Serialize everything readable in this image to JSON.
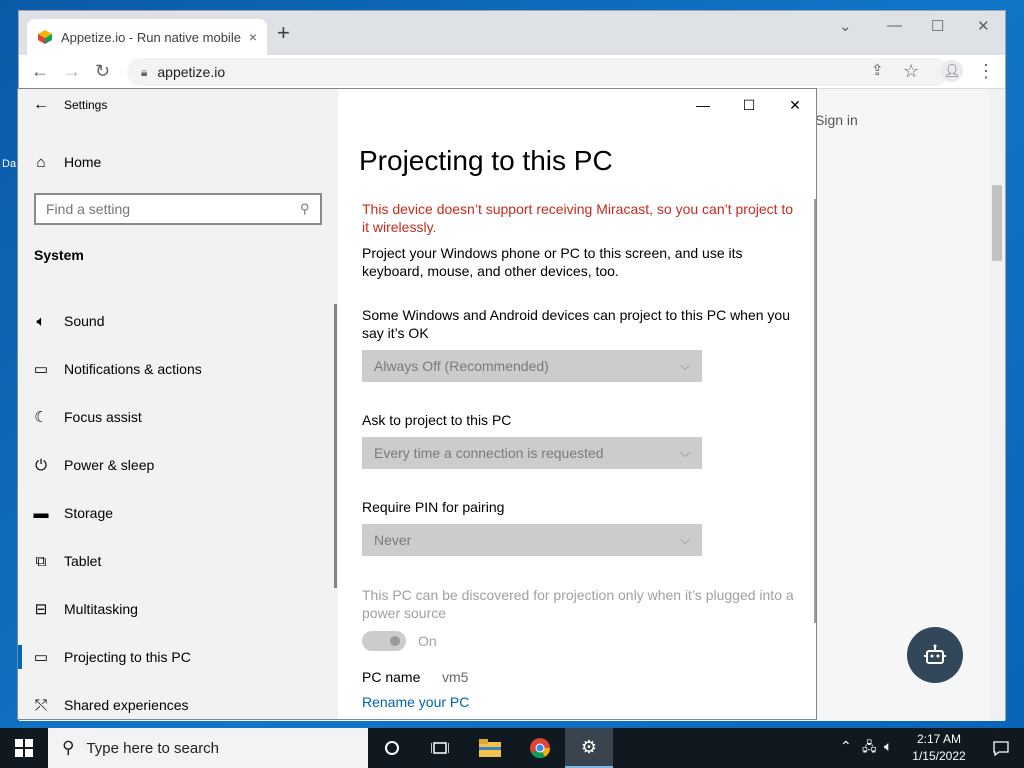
{
  "desktop": {
    "icon_label": "Da"
  },
  "browser": {
    "tab_title": "Appetize.io - Run native mobile apps in your browser",
    "tab_close": "×",
    "new_tab": "+",
    "url": "appetize.io",
    "page_signin": "Sign in",
    "fab_icon": "robot-icon"
  },
  "settings": {
    "app_title": "Settings",
    "home_label": "Home",
    "search_placeholder": "Find a setting",
    "section": "System",
    "nav_items": [
      {
        "label": "Sound",
        "icon": "speaker-icon"
      },
      {
        "label": "Notifications & actions",
        "icon": "notifications-icon"
      },
      {
        "label": "Focus assist",
        "icon": "moon-icon"
      },
      {
        "label": "Power & sleep",
        "icon": "power-icon"
      },
      {
        "label": "Storage",
        "icon": "storage-icon"
      },
      {
        "label": "Tablet",
        "icon": "tablet-icon"
      },
      {
        "label": "Multitasking",
        "icon": "multitasking-icon"
      },
      {
        "label": "Projecting to this PC",
        "icon": "projecting-icon",
        "selected": true
      },
      {
        "label": "Shared experiences",
        "icon": "shared-icon"
      }
    ],
    "page": {
      "title": "Projecting to this PC",
      "error": "This device doesn’t support receiving Miracast, so you can’t project to it wirelessly.",
      "description": "Project your Windows phone or PC to this screen, and use its keyboard, mouse, and other devices, too.",
      "projection_label": "Some Windows and Android devices can project to this PC when you say it’s OK",
      "projection_value": "Always Off (Recommended)",
      "ask_label": "Ask to project to this PC",
      "ask_value": "Every time a connection is requested",
      "pin_label": "Require PIN for pairing",
      "pin_value": "Never",
      "power_note": "This PC can be discovered for projection only when it’s plugged into a power source",
      "toggle_state": "On",
      "pc_name_label": "PC name",
      "pc_name_value": "vm5",
      "rename_link": "Rename your PC"
    }
  },
  "taskbar": {
    "search_placeholder": "Type here to search",
    "time": "2:17 AM",
    "date": "1/15/2022"
  }
}
